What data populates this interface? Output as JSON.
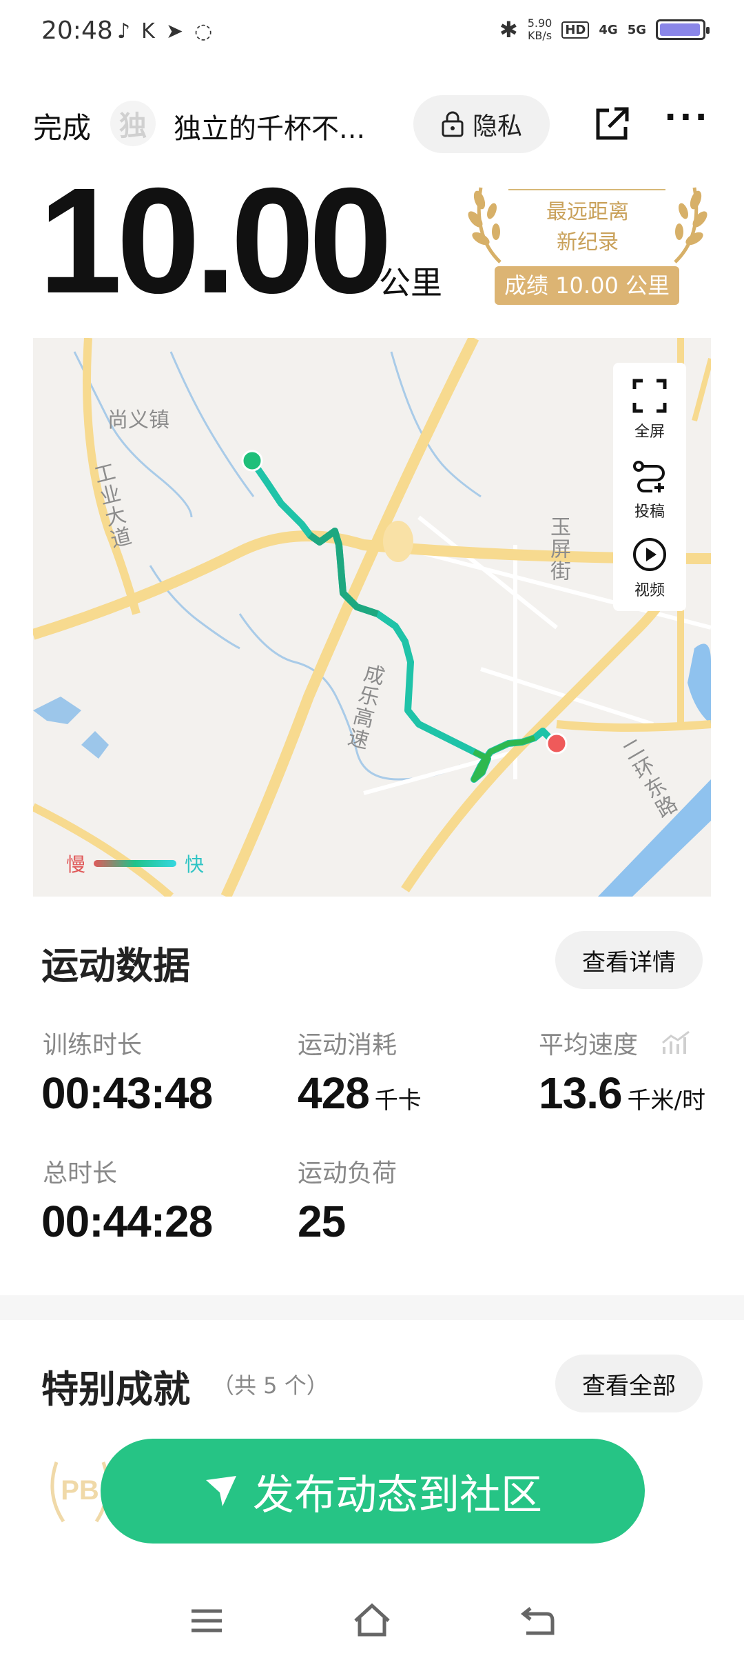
{
  "status_bar": {
    "time": "20:48",
    "net_speed_value": "5.90",
    "net_speed_unit": "KB/s",
    "hd": "HD",
    "net_4g": "4G",
    "net_5g": "5G"
  },
  "header": {
    "done_label": "完成",
    "avatar_char": "独",
    "username": "独立的千杯不...",
    "privacy_label": "隐私"
  },
  "summary": {
    "distance": "10.00",
    "distance_unit": "公里"
  },
  "award": {
    "line1": "最远距离",
    "line2": "新纪录",
    "badge": "成绩 10.00 公里"
  },
  "map": {
    "labels": {
      "town": "尚义镇",
      "road1": "工业大道",
      "street": "玉屏街",
      "highway": "成乐高速",
      "ring_road": "二环东路"
    },
    "tools": {
      "fullscreen": "全屏",
      "submit": "投稿",
      "video": "视频"
    },
    "legend": {
      "slow": "慢",
      "fast": "快"
    }
  },
  "sport_data": {
    "title": "运动数据",
    "details_button": "查看详情",
    "stats": [
      {
        "label": "训练时长",
        "value": "00:43:48",
        "unit": ""
      },
      {
        "label": "运动消耗",
        "value": "428",
        "unit": "千卡"
      },
      {
        "label": "平均速度",
        "value": "13.6",
        "unit": "千米/时"
      },
      {
        "label": "总时长",
        "value": "00:44:28",
        "unit": ""
      },
      {
        "label": "运动负荷",
        "value": "25",
        "unit": ""
      }
    ]
  },
  "achievements": {
    "title": "特别成就",
    "count_note": "（共 5 个）",
    "view_all_button": "查看全部",
    "pb_label": "PB"
  },
  "publish_button": "发布动态到社区",
  "colors": {
    "accent_green": "#26c485",
    "award_gold": "#dcb473",
    "route_start": "#1fbf7a",
    "route_end": "#ef5a5a"
  }
}
